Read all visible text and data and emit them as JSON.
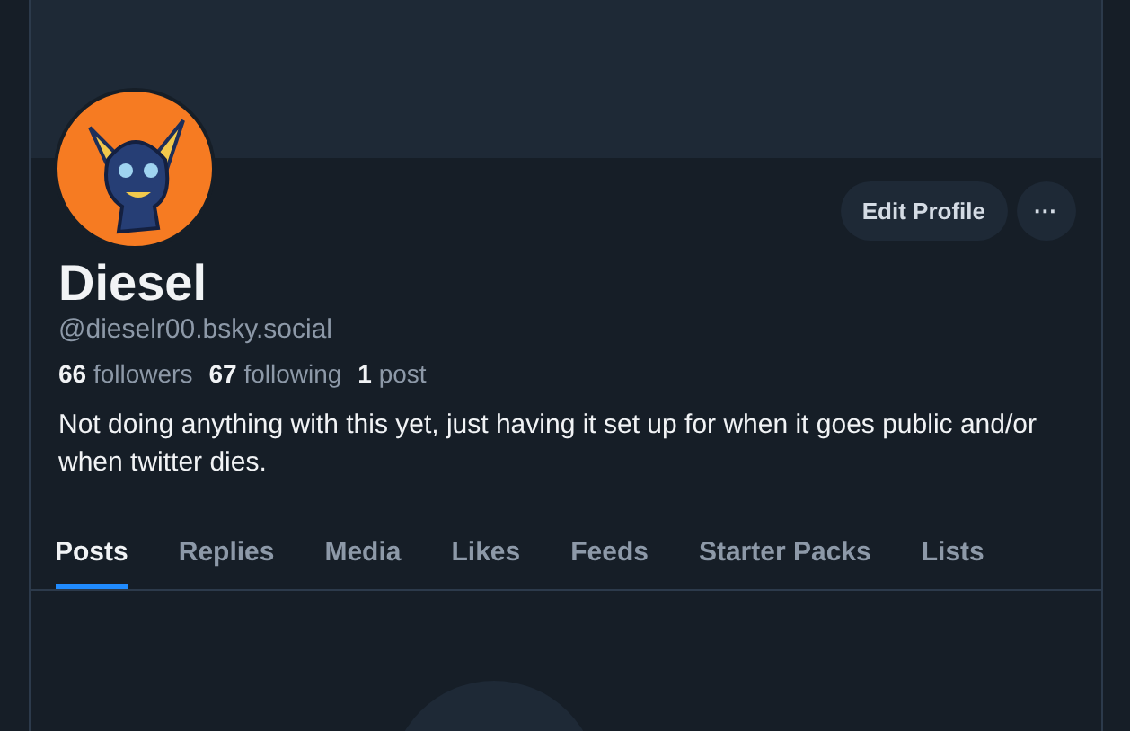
{
  "profile": {
    "name": "Diesel",
    "handle": "@dieselr00.bsky.social",
    "bio": "Not doing anything with this yet, just having it set up for when it goes public and/or when twitter dies."
  },
  "actions": {
    "edit_button": "Edit Profile",
    "more_button": "···"
  },
  "stats": [
    {
      "count": "66",
      "label": "followers"
    },
    {
      "count": "67",
      "label": "following"
    },
    {
      "count": "1",
      "label": "post"
    }
  ],
  "tabs": [
    {
      "label": "Posts",
      "selected": true
    },
    {
      "label": "Replies",
      "selected": false
    },
    {
      "label": "Media",
      "selected": false
    },
    {
      "label": "Likes",
      "selected": false
    },
    {
      "label": "Feeds",
      "selected": false
    },
    {
      "label": "Starter Packs",
      "selected": false
    },
    {
      "label": "Lists",
      "selected": false
    }
  ]
}
